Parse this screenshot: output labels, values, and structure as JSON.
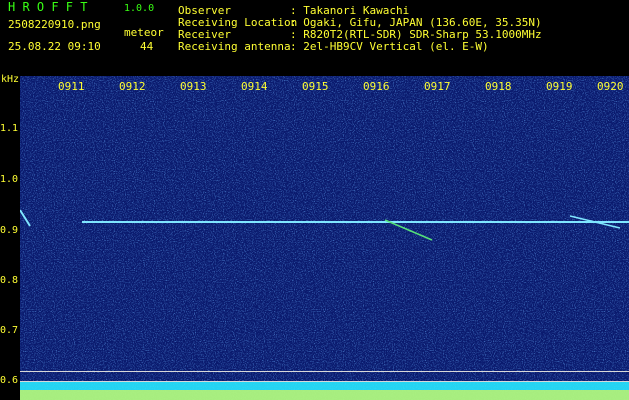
{
  "header": {
    "app_title": "H R O F F T",
    "version": "1.0.0",
    "filename": "2508220910.png",
    "datetime": "25.08.22 09:10",
    "meteor_label": "meteor",
    "meteor_count": "44",
    "info": [
      {
        "key": "Observer",
        "value": ": Takanori Kawachi"
      },
      {
        "key": "Receiving Location",
        "value": ": Ogaki, Gifu, JAPAN (136.60E, 35.35N)"
      },
      {
        "key": "Receiver",
        "value": ": R820T2(RTL-SDR) SDR-Sharp 53.1000MHz"
      },
      {
        "key": "Receiving antenna",
        "value": ": 2el-HB9CV Vertical (el. E-W)"
      }
    ]
  },
  "y_axis": {
    "unit": "kHz",
    "ticks": [
      "1.1",
      "1.0",
      "0.9",
      "0.8",
      "0.7",
      "0.6"
    ]
  },
  "x_axis": {
    "ticks": [
      "0911",
      "0912",
      "0913",
      "0914",
      "0915",
      "0916",
      "0917",
      "0918",
      "0919",
      "0920"
    ]
  },
  "colors": {
    "background": "#000000",
    "spectrogram_bg": "#0a1a6e",
    "label": "#ffff33",
    "title": "#39ff14",
    "signal": "#7fe6ff"
  }
}
